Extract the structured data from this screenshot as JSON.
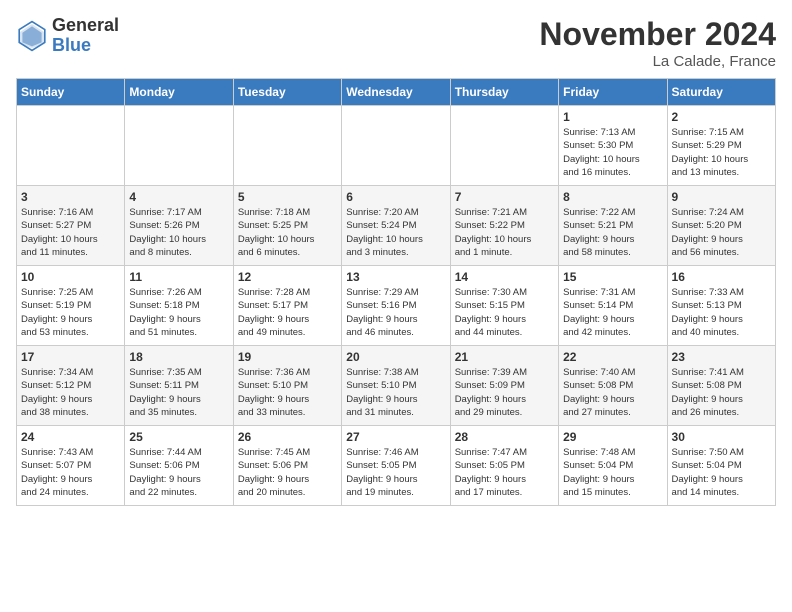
{
  "header": {
    "logo_general": "General",
    "logo_blue": "Blue",
    "month_title": "November 2024",
    "location": "La Calade, France"
  },
  "weekdays": [
    "Sunday",
    "Monday",
    "Tuesday",
    "Wednesday",
    "Thursday",
    "Friday",
    "Saturday"
  ],
  "weeks": [
    [
      {
        "day": "",
        "info": ""
      },
      {
        "day": "",
        "info": ""
      },
      {
        "day": "",
        "info": ""
      },
      {
        "day": "",
        "info": ""
      },
      {
        "day": "",
        "info": ""
      },
      {
        "day": "1",
        "info": "Sunrise: 7:13 AM\nSunset: 5:30 PM\nDaylight: 10 hours\nand 16 minutes."
      },
      {
        "day": "2",
        "info": "Sunrise: 7:15 AM\nSunset: 5:29 PM\nDaylight: 10 hours\nand 13 minutes."
      }
    ],
    [
      {
        "day": "3",
        "info": "Sunrise: 7:16 AM\nSunset: 5:27 PM\nDaylight: 10 hours\nand 11 minutes."
      },
      {
        "day": "4",
        "info": "Sunrise: 7:17 AM\nSunset: 5:26 PM\nDaylight: 10 hours\nand 8 minutes."
      },
      {
        "day": "5",
        "info": "Sunrise: 7:18 AM\nSunset: 5:25 PM\nDaylight: 10 hours\nand 6 minutes."
      },
      {
        "day": "6",
        "info": "Sunrise: 7:20 AM\nSunset: 5:24 PM\nDaylight: 10 hours\nand 3 minutes."
      },
      {
        "day": "7",
        "info": "Sunrise: 7:21 AM\nSunset: 5:22 PM\nDaylight: 10 hours\nand 1 minute."
      },
      {
        "day": "8",
        "info": "Sunrise: 7:22 AM\nSunset: 5:21 PM\nDaylight: 9 hours\nand 58 minutes."
      },
      {
        "day": "9",
        "info": "Sunrise: 7:24 AM\nSunset: 5:20 PM\nDaylight: 9 hours\nand 56 minutes."
      }
    ],
    [
      {
        "day": "10",
        "info": "Sunrise: 7:25 AM\nSunset: 5:19 PM\nDaylight: 9 hours\nand 53 minutes."
      },
      {
        "day": "11",
        "info": "Sunrise: 7:26 AM\nSunset: 5:18 PM\nDaylight: 9 hours\nand 51 minutes."
      },
      {
        "day": "12",
        "info": "Sunrise: 7:28 AM\nSunset: 5:17 PM\nDaylight: 9 hours\nand 49 minutes."
      },
      {
        "day": "13",
        "info": "Sunrise: 7:29 AM\nSunset: 5:16 PM\nDaylight: 9 hours\nand 46 minutes."
      },
      {
        "day": "14",
        "info": "Sunrise: 7:30 AM\nSunset: 5:15 PM\nDaylight: 9 hours\nand 44 minutes."
      },
      {
        "day": "15",
        "info": "Sunrise: 7:31 AM\nSunset: 5:14 PM\nDaylight: 9 hours\nand 42 minutes."
      },
      {
        "day": "16",
        "info": "Sunrise: 7:33 AM\nSunset: 5:13 PM\nDaylight: 9 hours\nand 40 minutes."
      }
    ],
    [
      {
        "day": "17",
        "info": "Sunrise: 7:34 AM\nSunset: 5:12 PM\nDaylight: 9 hours\nand 38 minutes."
      },
      {
        "day": "18",
        "info": "Sunrise: 7:35 AM\nSunset: 5:11 PM\nDaylight: 9 hours\nand 35 minutes."
      },
      {
        "day": "19",
        "info": "Sunrise: 7:36 AM\nSunset: 5:10 PM\nDaylight: 9 hours\nand 33 minutes."
      },
      {
        "day": "20",
        "info": "Sunrise: 7:38 AM\nSunset: 5:10 PM\nDaylight: 9 hours\nand 31 minutes."
      },
      {
        "day": "21",
        "info": "Sunrise: 7:39 AM\nSunset: 5:09 PM\nDaylight: 9 hours\nand 29 minutes."
      },
      {
        "day": "22",
        "info": "Sunrise: 7:40 AM\nSunset: 5:08 PM\nDaylight: 9 hours\nand 27 minutes."
      },
      {
        "day": "23",
        "info": "Sunrise: 7:41 AM\nSunset: 5:08 PM\nDaylight: 9 hours\nand 26 minutes."
      }
    ],
    [
      {
        "day": "24",
        "info": "Sunrise: 7:43 AM\nSunset: 5:07 PM\nDaylight: 9 hours\nand 24 minutes."
      },
      {
        "day": "25",
        "info": "Sunrise: 7:44 AM\nSunset: 5:06 PM\nDaylight: 9 hours\nand 22 minutes."
      },
      {
        "day": "26",
        "info": "Sunrise: 7:45 AM\nSunset: 5:06 PM\nDaylight: 9 hours\nand 20 minutes."
      },
      {
        "day": "27",
        "info": "Sunrise: 7:46 AM\nSunset: 5:05 PM\nDaylight: 9 hours\nand 19 minutes."
      },
      {
        "day": "28",
        "info": "Sunrise: 7:47 AM\nSunset: 5:05 PM\nDaylight: 9 hours\nand 17 minutes."
      },
      {
        "day": "29",
        "info": "Sunrise: 7:48 AM\nSunset: 5:04 PM\nDaylight: 9 hours\nand 15 minutes."
      },
      {
        "day": "30",
        "info": "Sunrise: 7:50 AM\nSunset: 5:04 PM\nDaylight: 9 hours\nand 14 minutes."
      }
    ]
  ]
}
